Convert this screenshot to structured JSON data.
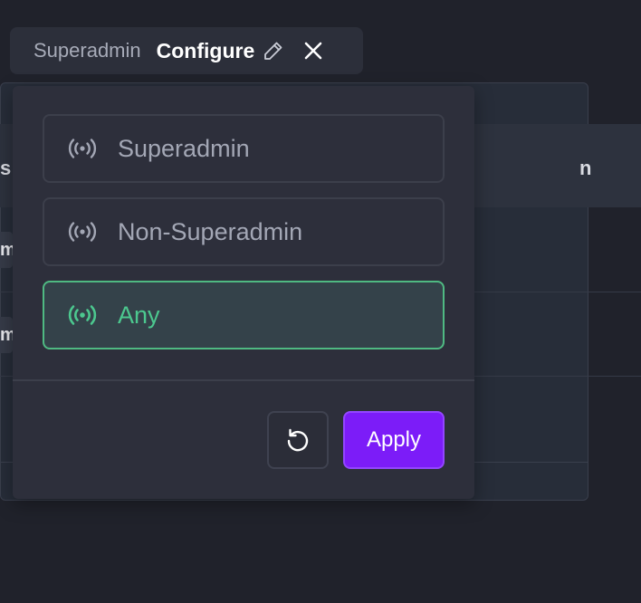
{
  "filter_chip": {
    "field_label": "Superadmin",
    "value_label": "Configure",
    "edit_icon": "pencil-icon",
    "close_icon": "close-icon"
  },
  "popover": {
    "options": [
      {
        "label": "Superadmin",
        "icon": "broadcast-icon",
        "selected": false
      },
      {
        "label": "Non-Superadmin",
        "icon": "broadcast-icon",
        "selected": false
      },
      {
        "label": "Any",
        "icon": "broadcast-icon",
        "selected": true
      }
    ],
    "reset_icon": "reset-icon",
    "apply_label": "Apply"
  },
  "background": {
    "header_left_fragment": "s",
    "header_right_fragment": "n",
    "row_fragments": [
      "m",
      "m"
    ]
  },
  "colors": {
    "accent": "#7c1cf8",
    "selected_green": "#4cc88f",
    "background": "#20222b"
  }
}
